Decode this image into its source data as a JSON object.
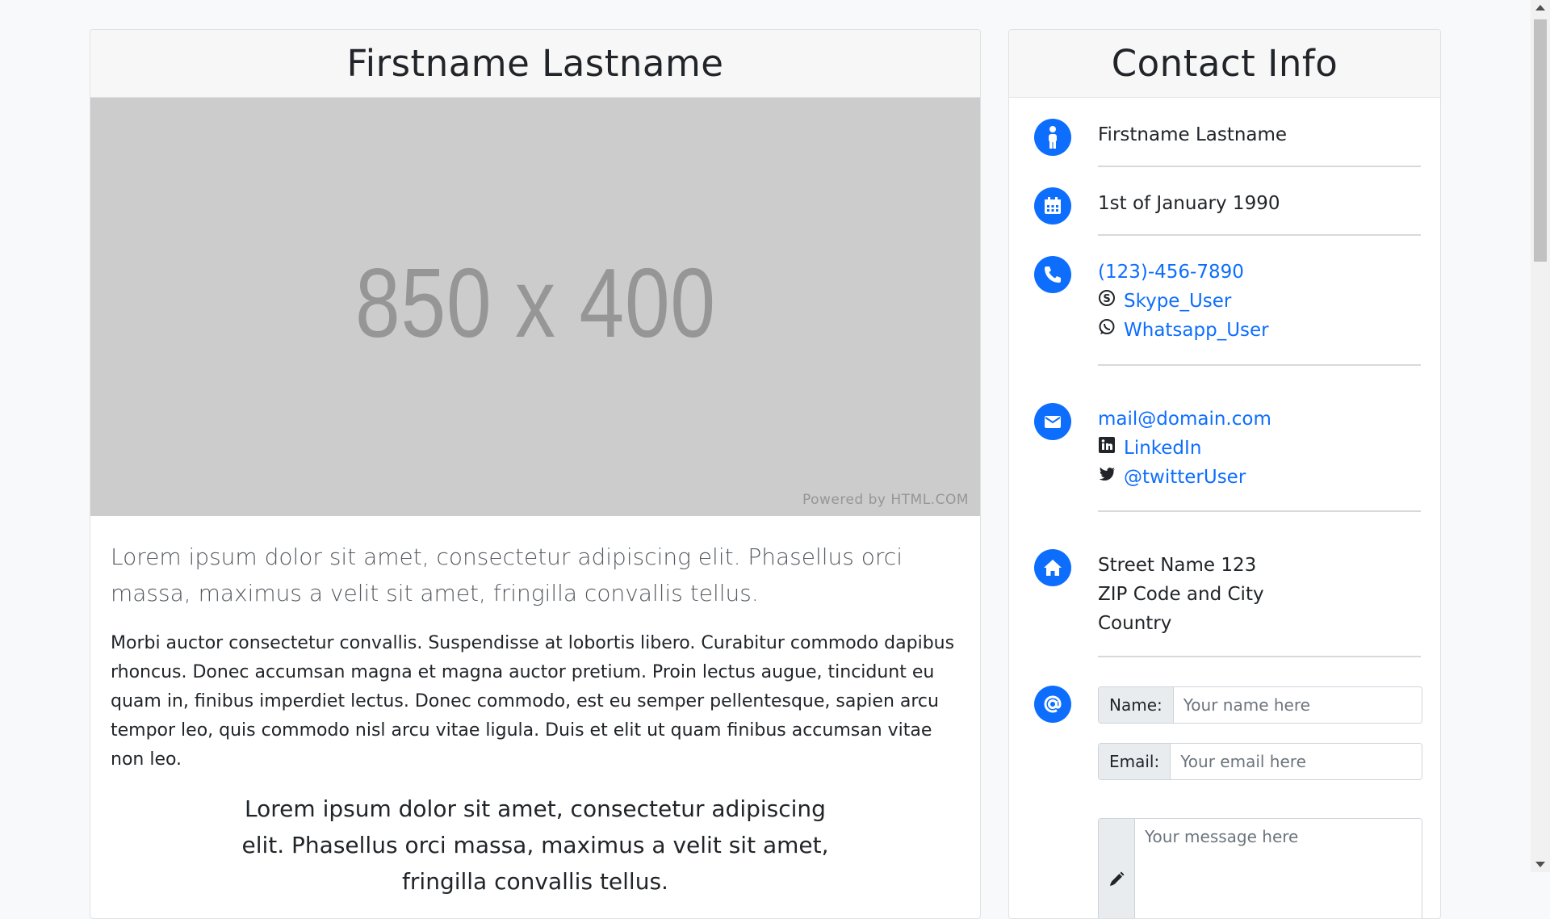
{
  "profile": {
    "name": "Firstname Lastname",
    "image_text": "850 x 400",
    "image_credit": "Powered by HTML.COM",
    "lead": "Lorem ipsum dolor sit amet, consectetur adipiscing elit. Phasellus orci massa, maximus a velit sit amet, fringilla convallis tellus.",
    "body": "Morbi auctor consectetur convallis. Suspendisse at lobortis libero. Curabitur commodo dapibus rhoncus. Donec accumsan magna et magna auctor pretium. Proin lectus augue, tincidunt eu quam in, finibus imperdiet lectus. Donec commodo, est eu semper pellentesque, sapien arcu tempor leo, quis commodo nisl arcu vitae ligula. Duis et elit ut quam finibus accumsan vitae non leo.",
    "quote": "Lorem ipsum dolor sit amet, consectetur adipiscing elit. Phasellus orci massa, maximus a velit sit amet, fringilla convallis tellus."
  },
  "contact": {
    "title": "Contact Info",
    "name": "Firstname Lastname",
    "birthday": "1st of January 1990",
    "phone": "(123)-456-7890",
    "skype": "Skype_User",
    "whatsapp": "Whatsapp_User",
    "email": "mail@domain.com",
    "linkedin": "LinkedIn",
    "twitter": "@twitterUser",
    "address": {
      "street": "Street Name 123",
      "zip_city": "ZIP Code and City",
      "country": "Country"
    },
    "form": {
      "name_label": "Name:",
      "name_placeholder": "Your name here",
      "email_label": "Email:",
      "email_placeholder": "Your email here",
      "message_placeholder": "Your message here"
    }
  },
  "colors": {
    "accent": "#0d6efd",
    "header_bg": "#f7f7f7",
    "placeholder_bg": "#cccccc"
  },
  "icons": [
    "person-icon",
    "calendar-icon",
    "phone-icon",
    "skype-icon",
    "whatsapp-icon",
    "envelope-icon",
    "linkedin-icon",
    "twitter-icon",
    "home-icon",
    "at-icon",
    "pencil-icon"
  ]
}
